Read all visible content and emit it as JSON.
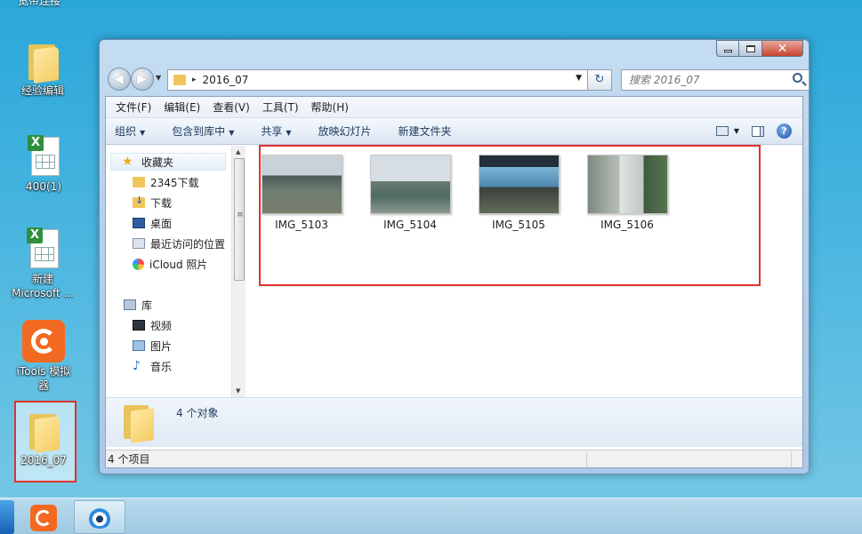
{
  "desktop": {
    "top_partial_label": "宽带连接",
    "icons": [
      {
        "label": "经验编辑",
        "icon": "folder-icon"
      },
      {
        "label": "400(1)",
        "icon": "excel-file-icon"
      },
      {
        "label": "新建 Microsoft ...",
        "icon": "excel-file-icon"
      },
      {
        "label": "iTools 模拟器",
        "icon": "itools-icon"
      },
      {
        "label": "2016_07",
        "icon": "folder-icon"
      }
    ]
  },
  "window": {
    "caption_buttons": {
      "minimize": "minimize",
      "maximize": "maximize",
      "close": "✕"
    },
    "address": {
      "path": "2016_07",
      "separator": "▸",
      "dropdown": "▼"
    },
    "refresh_glyph": "↻",
    "search": {
      "placeholder": "搜索 2016_07"
    },
    "menu": [
      "文件(F)",
      "编辑(E)",
      "查看(V)",
      "工具(T)",
      "帮助(H)"
    ],
    "toolbar": {
      "items": [
        "组织",
        "包含到库中",
        "共享",
        "放映幻灯片",
        "新建文件夹"
      ],
      "help": "?"
    },
    "nav": {
      "favorites_header": "收藏夹",
      "favorites": [
        "2345下载",
        "下载",
        "桌面",
        "最近访问的位置",
        "iCloud 照片"
      ],
      "libraries_header": "库",
      "libraries": [
        "视频",
        "图片",
        "音乐"
      ]
    },
    "files": [
      {
        "name": "IMG_5103"
      },
      {
        "name": "IMG_5104"
      },
      {
        "name": "IMG_5105"
      },
      {
        "name": "IMG_5106"
      }
    ],
    "details": {
      "count": "4 个对象"
    },
    "status": {
      "items": "4 个项目"
    }
  },
  "colors": {
    "highlight": "#e0302f",
    "desktop": "#2aa7d9"
  }
}
